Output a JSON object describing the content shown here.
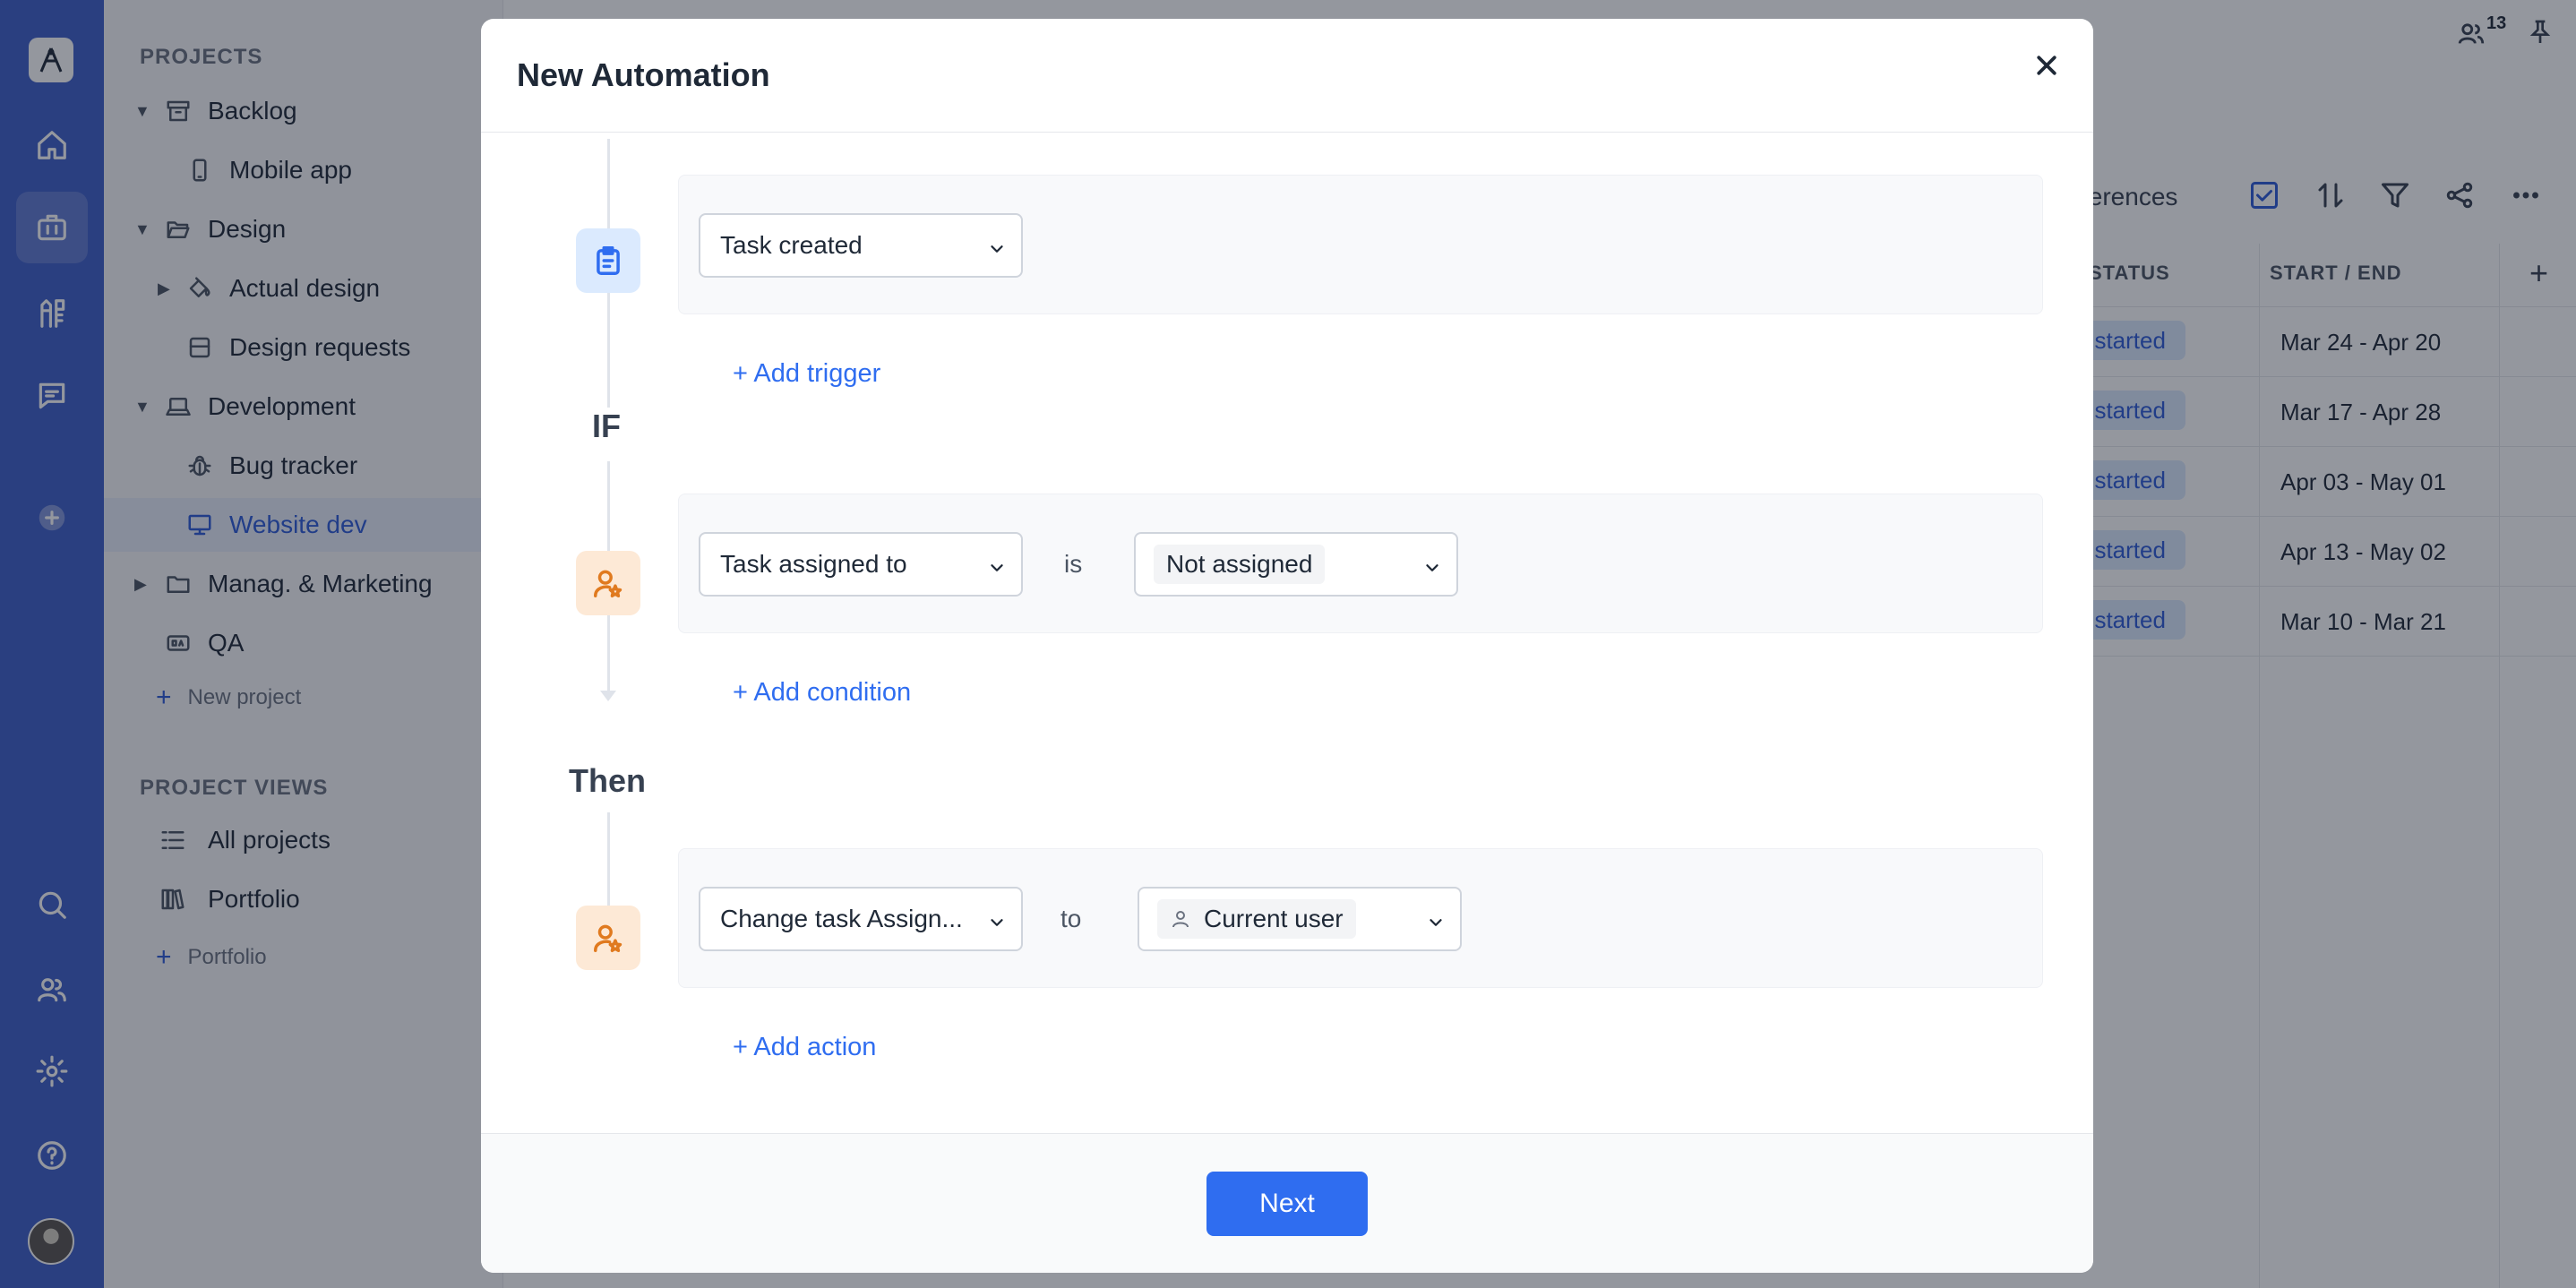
{
  "sidebar": {
    "projects_heading": "PROJECTS",
    "items": [
      {
        "label": "Backlog"
      },
      {
        "label": "Mobile app"
      },
      {
        "label": "Design"
      },
      {
        "label": "Actual design"
      },
      {
        "label": "Design requests"
      },
      {
        "label": "Development"
      },
      {
        "label": "Bug tracker"
      },
      {
        "label": "Website dev"
      },
      {
        "label": "Manag. & Marketing"
      },
      {
        "label": "QA"
      }
    ],
    "new_project": "New project",
    "views_heading": "PROJECT VIEWS",
    "views": [
      {
        "label": "All projects"
      },
      {
        "label": "Portfolio"
      }
    ],
    "add_portfolio": "Portfolio",
    "active_item": "Website dev"
  },
  "main": {
    "members_count": "13",
    "toolbar_text": "ferences",
    "columns": {
      "status": "STATUS",
      "start_end": "START / END"
    },
    "rows": [
      {
        "status": "t started",
        "dates": "Mar 24 - Apr 20"
      },
      {
        "status": "t started",
        "dates": "Mar 17 - Apr 28"
      },
      {
        "status": "t started",
        "dates": "Apr 03 - May 01"
      },
      {
        "status": "t started",
        "dates": "Apr 13 - May 02"
      },
      {
        "status": "t started",
        "dates": "Mar 10 - Mar 21"
      }
    ]
  },
  "modal": {
    "title": "New Automation",
    "trigger": {
      "select_value": "Task created",
      "add_label": "+ Add trigger"
    },
    "if_label": "IF",
    "condition": {
      "field_value": "Task assigned to",
      "operator": "is",
      "value": "Not assigned",
      "add_label": "+ Add condition"
    },
    "then_label": "Then",
    "action": {
      "field_value": "Change task Assign...",
      "connector": "to",
      "value": "Current user",
      "add_label": "+ Add action"
    },
    "next_label": "Next"
  },
  "colors": {
    "rail": "#3f5fc8",
    "accent": "#2f6df0",
    "status_pill_bg": "#dbeafe",
    "trigger_badge_bg": "#dbeafe",
    "action_badge_bg": "#fde9d6"
  }
}
